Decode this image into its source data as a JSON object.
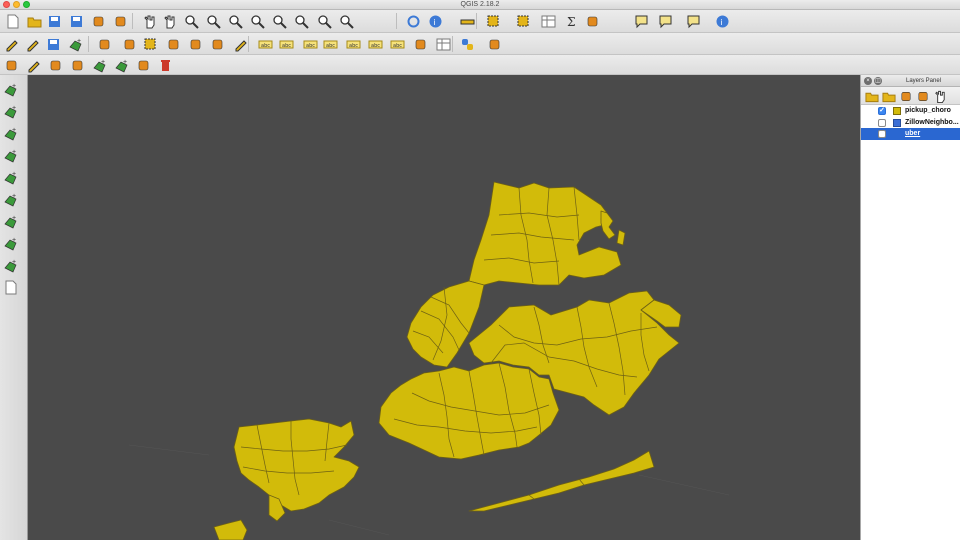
{
  "window": {
    "title": "QGIS 2.18.2"
  },
  "colors": {
    "canvas": "#4a4a4a",
    "fill": "#d2bb0a",
    "stroke": "#6e6114",
    "selection": "#2a67d1"
  },
  "toolbar_icons": {
    "row1": [
      "new-project-icon",
      "open-project-icon",
      "save-project-icon",
      "save-as-icon",
      "print-composer-icon",
      "composer-manager-icon",
      "pan-icon",
      "pan-to-selection-icon",
      "zoom-in-icon",
      "zoom-out-icon",
      "zoom-full-icon",
      "zoom-to-selection-icon",
      "zoom-to-layer-icon",
      "zoom-native-icon",
      "zoom-last-icon",
      "zoom-next-icon",
      "refresh-icon",
      "identify-icon",
      "measure-icon",
      "select-features-icon",
      "deselect-icon",
      "attribute-table-icon",
      "statistics-icon",
      "field-calculator-icon",
      "annotation-icon",
      "map-tips-icon",
      "text-annotation-icon",
      "help-icon"
    ],
    "row2": [
      "current-edits-icon",
      "toggle-edit-icon",
      "save-edits-icon",
      "add-feature-icon",
      "move-feature-icon",
      "node-tool-icon",
      "delete-selected-icon",
      "cut-features-icon",
      "copy-features-icon",
      "paste-features-icon",
      "digitize-icon",
      "label-icon",
      "pin-labels-icon",
      "show-hide-labels-icon",
      "move-label-icon",
      "rotate-label-icon",
      "change-label-icon",
      "label-tool-icon",
      "db-manager-icon",
      "csv-icon",
      "python-console-icon",
      "plugin-icon"
    ],
    "row3": [
      "snapping-icon",
      "advanced-digitize-icon",
      "rotate-feature-icon",
      "simplify-icon",
      "add-ring-icon",
      "add-part-icon",
      "fill-ring-icon",
      "delete-ring-icon"
    ],
    "left": [
      "add-vector-layer-icon",
      "add-raster-layer-icon",
      "add-spatialite-icon",
      "add-postgis-icon",
      "add-wms-icon",
      "add-wcs-icon",
      "add-wfs-icon",
      "add-mssql-icon",
      "add-oracle-icon",
      "new-layer-icon"
    ]
  },
  "layers_panel": {
    "title": "Layers Panel",
    "toolbar_icons": [
      "open-style-icon",
      "add-group-icon",
      "manage-visibility-icon",
      "filter-legend-icon",
      "expand-all-icon"
    ],
    "layers": [
      {
        "name": "pickup_choro",
        "checked": true,
        "symbol": "polygon-yellow",
        "selected": false
      },
      {
        "name": "ZillowNeighbo...",
        "checked": false,
        "symbol": "polygon-blue",
        "selected": false
      },
      {
        "name": "uber",
        "checked": false,
        "symbol": "",
        "selected": true
      }
    ]
  }
}
